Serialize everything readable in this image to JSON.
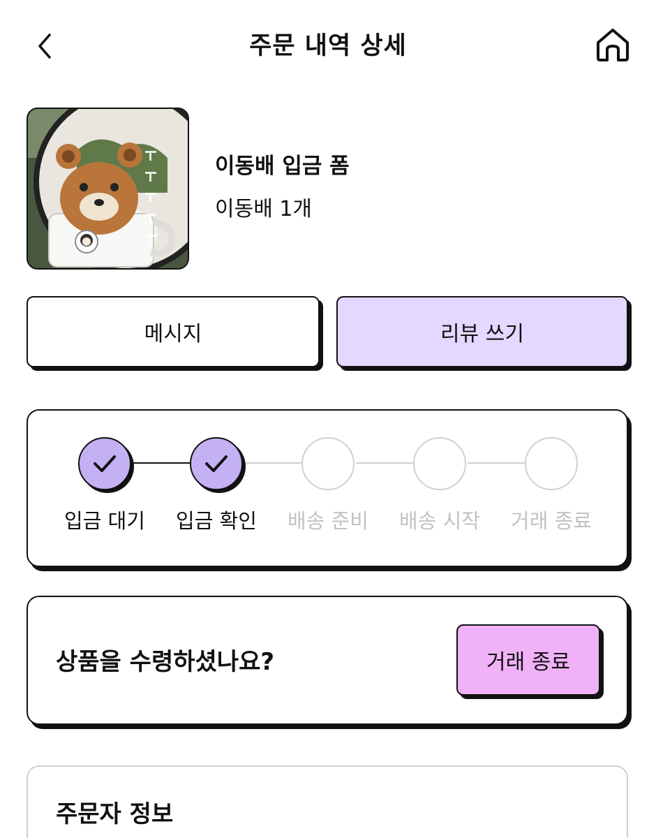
{
  "header": {
    "title": "주문 내역 상세",
    "back_icon": "chevron-left-icon",
    "home_icon": "home-icon"
  },
  "product": {
    "name": "이동배 입금 폼",
    "quantity": "이동배 1개"
  },
  "actions": {
    "message_label": "메시지",
    "review_label": "리뷰 쓰기",
    "review_color": "#e3d8ff"
  },
  "progress": {
    "steps": [
      {
        "label": "입금 대기",
        "done": true
      },
      {
        "label": "입금 확인",
        "done": true
      },
      {
        "label": "배송 준비",
        "done": false
      },
      {
        "label": "배송 시작",
        "done": false
      },
      {
        "label": "거래 종료",
        "done": false
      }
    ],
    "done_color": "#c4b1f4",
    "todo_color": "#d0d0d0"
  },
  "receipt": {
    "question": "상품을 수령하셨나요?",
    "complete_label": "거래 종료",
    "complete_color": "#f1b1f7"
  },
  "orderer": {
    "title": "주문자 정보"
  }
}
